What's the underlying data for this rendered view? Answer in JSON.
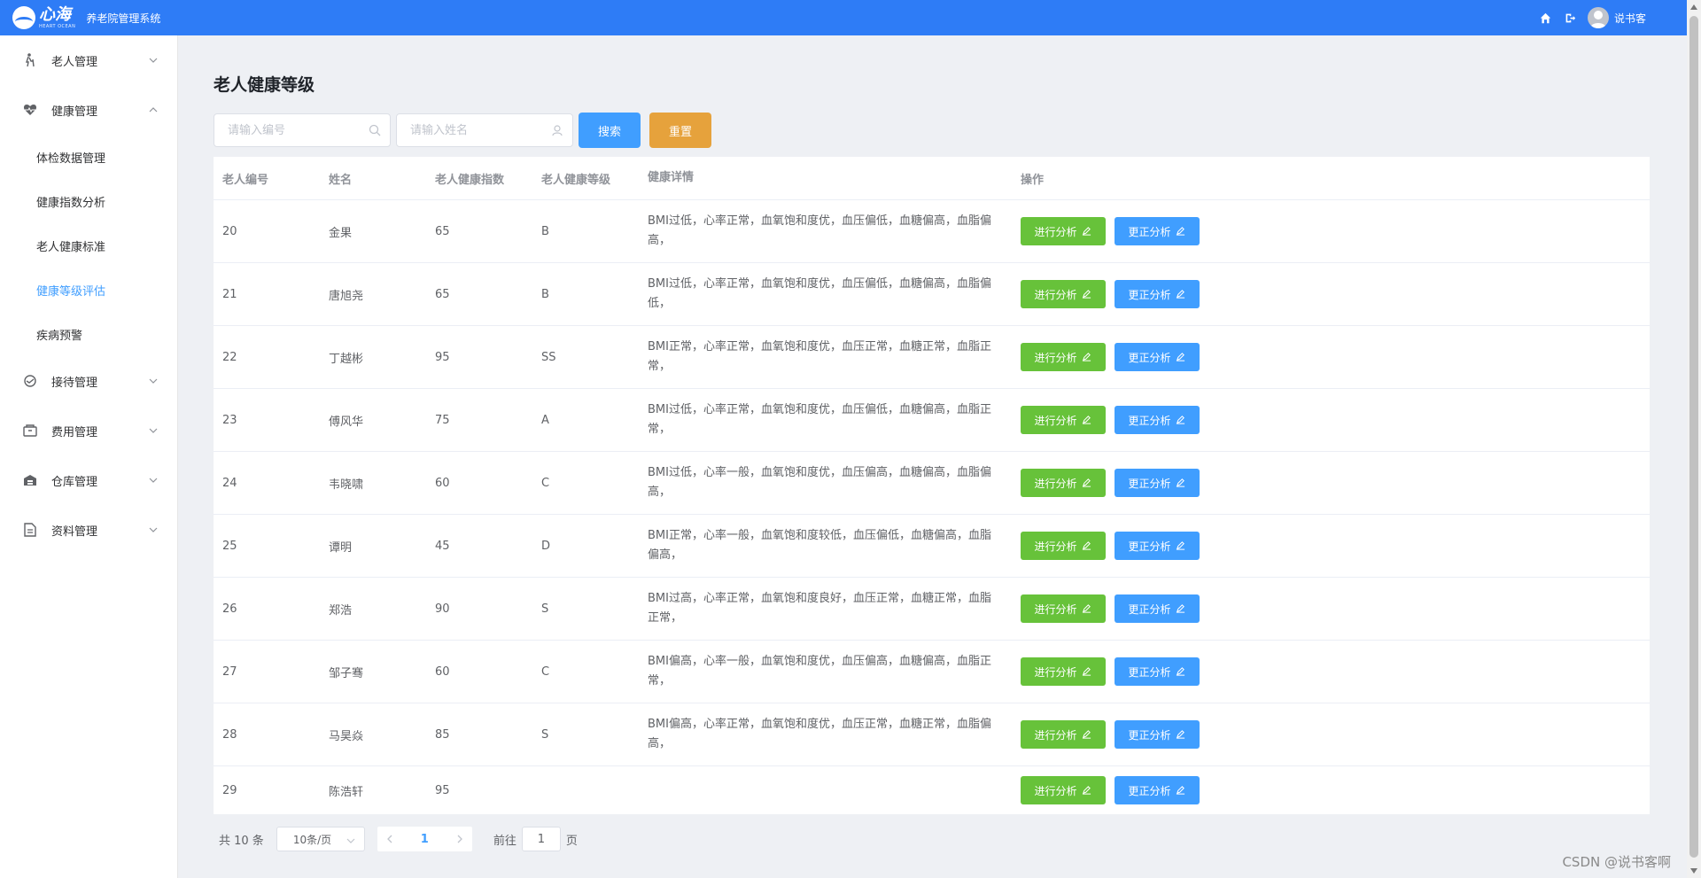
{
  "app": {
    "logo_text": "心海",
    "logo_sub": "HEART OCEAN",
    "system_title": "养老院管理系统",
    "user_name": "说书客"
  },
  "header_icons": [
    "home-icon",
    "logout-icon",
    "user-avatar-icon"
  ],
  "sidebar": {
    "items": [
      {
        "label": "老人管理",
        "icon": "cane-person-icon",
        "expanded": false
      },
      {
        "label": "健康管理",
        "icon": "heart-pulse-icon",
        "expanded": true,
        "children": [
          {
            "label": "体检数据管理",
            "active": false
          },
          {
            "label": "健康指数分析",
            "active": false
          },
          {
            "label": "老人健康标准",
            "active": false
          },
          {
            "label": "健康等级评估",
            "active": true
          },
          {
            "label": "疾病预警",
            "active": false
          }
        ]
      },
      {
        "label": "接待管理",
        "icon": "handshake-icon",
        "expanded": false
      },
      {
        "label": "费用管理",
        "icon": "wallet-icon",
        "expanded": false
      },
      {
        "label": "仓库管理",
        "icon": "warehouse-icon",
        "expanded": false
      },
      {
        "label": "资料管理",
        "icon": "document-icon",
        "expanded": false
      }
    ]
  },
  "page": {
    "title": "老人健康等级"
  },
  "search": {
    "id_placeholder": "请输入编号",
    "name_placeholder": "请输入姓名",
    "search_label": "搜索",
    "reset_label": "重置"
  },
  "table": {
    "columns": [
      "老人编号",
      "姓名",
      "老人健康指数",
      "老人健康等级",
      "健康详情",
      "操作"
    ],
    "rows": [
      {
        "id": "20",
        "name": "金果",
        "index": "65",
        "level": "B",
        "detail": "BMI过低，心率正常，血氧饱和度优，血压偏低，血糖偏高，血脂偏高，"
      },
      {
        "id": "21",
        "name": "唐旭尧",
        "index": "65",
        "level": "B",
        "detail": "BMI过低，心率正常，血氧饱和度优，血压偏低，血糖偏高，血脂偏低，"
      },
      {
        "id": "22",
        "name": "丁越彬",
        "index": "95",
        "level": "SS",
        "detail": "BMI正常，心率正常，血氧饱和度优，血压正常，血糖正常，血脂正常，"
      },
      {
        "id": "23",
        "name": "傅风华",
        "index": "75",
        "level": "A",
        "detail": "BMI过低，心率正常，血氧饱和度优，血压偏低，血糖偏高，血脂正常，"
      },
      {
        "id": "24",
        "name": "韦晓啸",
        "index": "60",
        "level": "C",
        "detail": "BMI过低，心率一般，血氧饱和度优，血压偏高，血糖偏高，血脂偏高，"
      },
      {
        "id": "25",
        "name": "谭明",
        "index": "45",
        "level": "D",
        "detail": "BMI正常，心率一般，血氧饱和度较低，血压偏低，血糖偏高，血脂偏高，"
      },
      {
        "id": "26",
        "name": "郑浩",
        "index": "90",
        "level": "S",
        "detail": "BMI过高，心率正常，血氧饱和度良好，血压正常，血糖正常，血脂正常，"
      },
      {
        "id": "27",
        "name": "邹子骞",
        "index": "60",
        "level": "C",
        "detail": "BMI偏高，心率一般，血氧饱和度优，血压偏高，血糖偏高，血脂正常，"
      },
      {
        "id": "28",
        "name": "马昊焱",
        "index": "85",
        "level": "S",
        "detail": "BMI偏高，心率正常，血氧饱和度优，血压正常，血糖正常，血脂偏高，"
      },
      {
        "id": "29",
        "name": "陈浩轩",
        "index": "95",
        "level": "",
        "detail": ""
      }
    ],
    "actions": {
      "analyze_label": "进行分析",
      "correct_label": "更正分析"
    }
  },
  "pagination": {
    "total_text": "共 10 条",
    "page_size": "10条/页",
    "current_page": "1",
    "goto_prefix": "前往",
    "goto_value": "1",
    "goto_suffix": "页"
  },
  "watermark": "CSDN @说书客啊",
  "colors": {
    "topbar": "#2e7cf6",
    "primary": "#409eff",
    "success": "#67c23a",
    "warning": "#e6a23c"
  }
}
